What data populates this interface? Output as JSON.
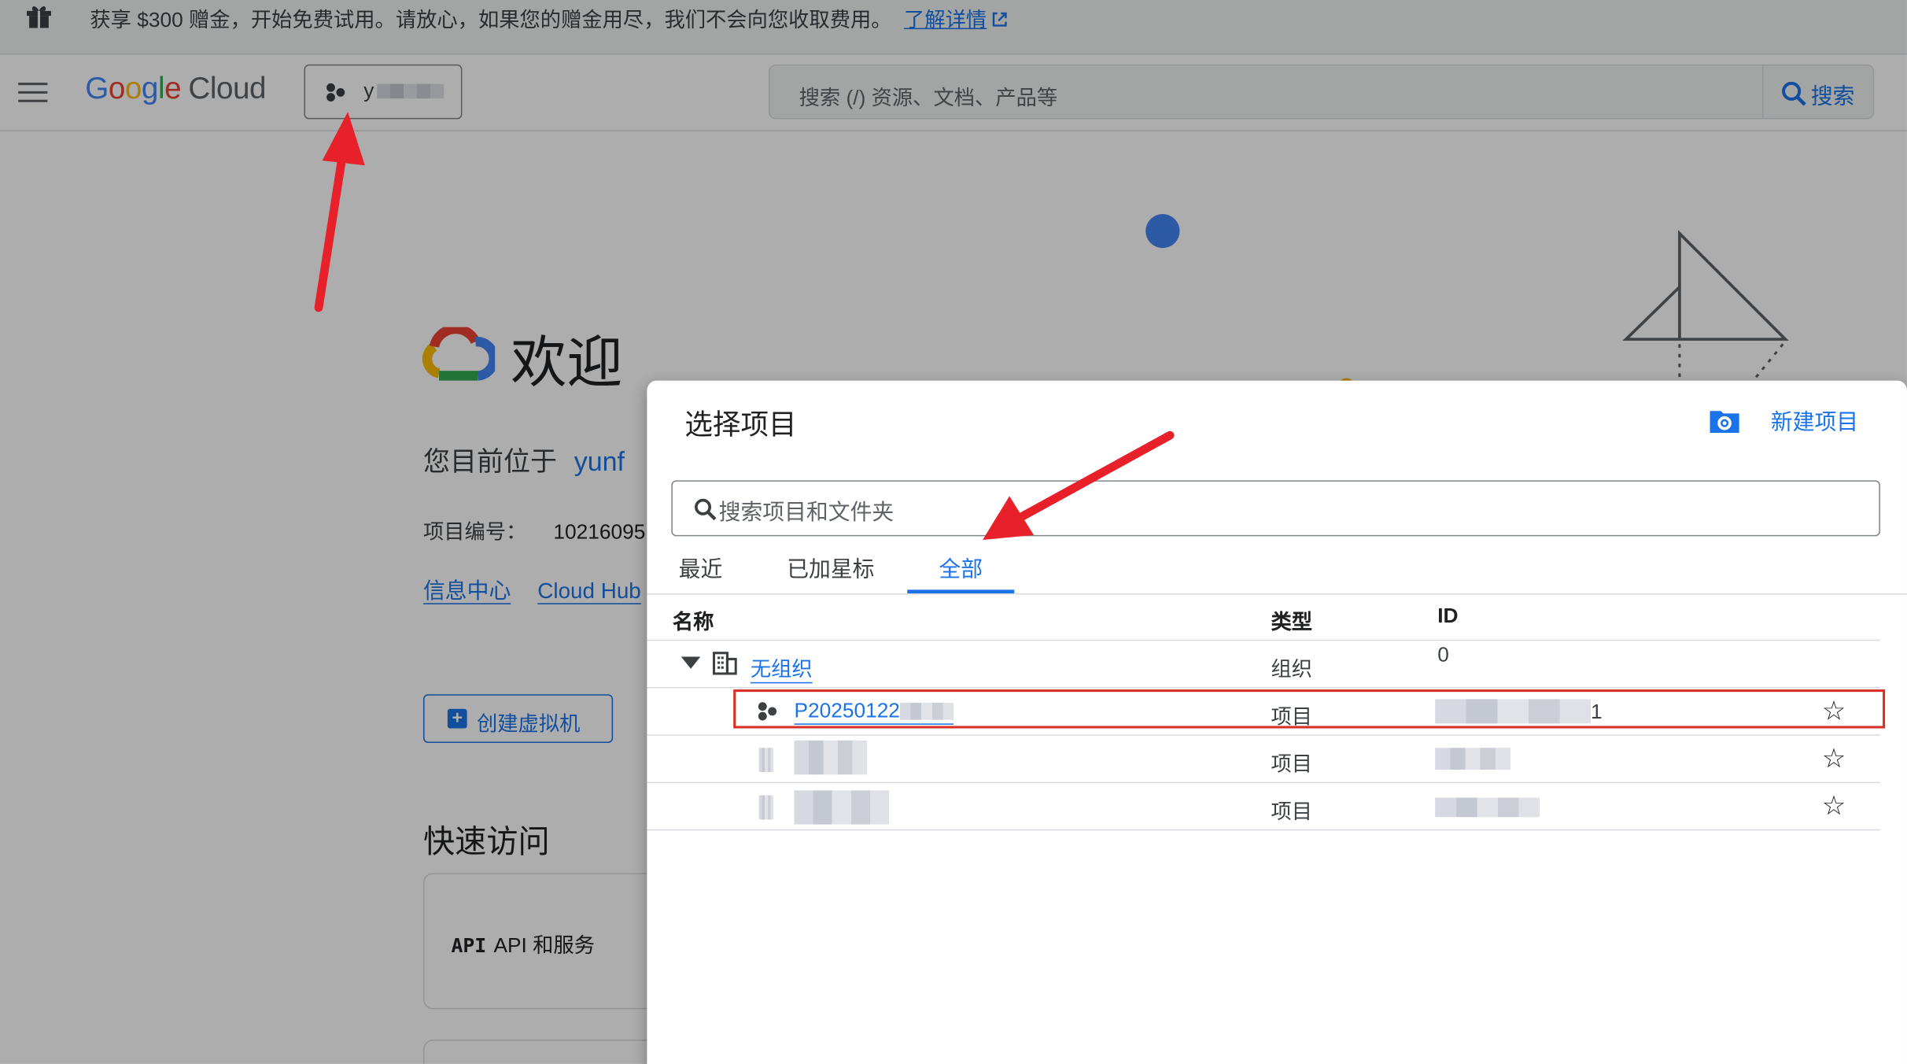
{
  "banner": {
    "text": "获享 $300 赠金，开始免费试用。请放心，如果您的赠金用尽，我们不会向您收取费用。",
    "link": "了解详情",
    "icons": [
      "gift-icon",
      "external-link-icon"
    ]
  },
  "header": {
    "logo_google": [
      "G",
      "o",
      "o",
      "g",
      "l",
      "e"
    ],
    "logo_cloud": "Cloud",
    "project_name_visible": "y",
    "search_placeholder": "搜索 (/) 资源、文档、产品等",
    "search_button": "搜索"
  },
  "welcome": {
    "title": "欢迎",
    "location_label": "您目前位于",
    "location_value": "yunf",
    "project_number_label": "项目编号：",
    "project_number_value": "10216095",
    "links": [
      "信息中心",
      "Cloud Hub"
    ],
    "create_vm": "创建虚拟机",
    "quick_access": "快速访问",
    "card_api_glyph": "API",
    "card_label": "API 和服务"
  },
  "dialog": {
    "title": "选择项目",
    "new_project": "新建项目",
    "search_placeholder": "搜索项目和文件夹",
    "tabs": [
      "最近",
      "已加星标",
      "全部"
    ],
    "active_tab": "全部",
    "columns": {
      "name": "名称",
      "type": "类型",
      "id": "ID"
    },
    "rows": [
      {
        "name": "无组织",
        "type": "组织",
        "id": "0",
        "kind": "organization"
      },
      {
        "name": "P20250122",
        "type": "项目",
        "id": "1",
        "kind": "project",
        "highlighted": true
      },
      {
        "name": "",
        "type": "项目",
        "id": "",
        "kind": "project"
      },
      {
        "name": "",
        "type": "项目",
        "id": "",
        "kind": "project"
      }
    ]
  },
  "colors": {
    "accent": "#1a73e8",
    "arrow": "#e8202a",
    "highlight_border": "#d93025"
  }
}
